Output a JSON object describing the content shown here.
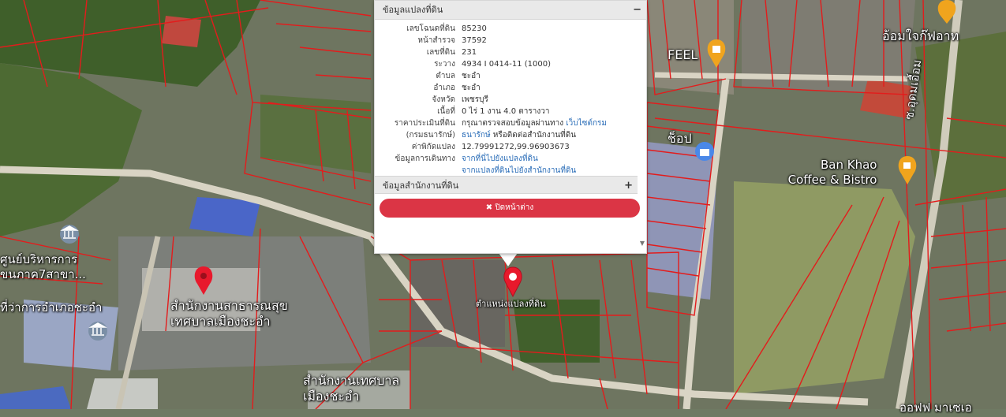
{
  "popup": {
    "section1_title": "ข้อมูลแปลงที่ดิน",
    "section1_toggle": "−",
    "rows": [
      {
        "key": "เลขโฉนดที่ดิน",
        "value": "85230"
      },
      {
        "key": "หน้าสำรวจ",
        "value": "37592"
      },
      {
        "key": "เลขที่ดิน",
        "value": "231"
      },
      {
        "key": "ระวาง",
        "value": "4934 I 0414-11 (1000)"
      },
      {
        "key": "ตำบล",
        "value": "ชะอำ"
      },
      {
        "key": "อำเภอ",
        "value": "ชะอำ"
      },
      {
        "key": "จังหวัด",
        "value": "เพชรบุรี"
      },
      {
        "key": "เนื้อที่",
        "value": "0 ไร่ 1 งาน 4.0 ตารางวา"
      }
    ],
    "price_key_1": "ราคาประเมินที่ดิน",
    "price_key_2": "(กรมธนารักษ์)",
    "price_text": "กรุณาตรวจสอบข้อมูลผ่านทาง",
    "price_link_1": "เว็บไซต์กรม",
    "price_link_2": "ธนารักษ์",
    "price_text_2": "หรือติดต่อสำนักงานที่ดิน",
    "coord_key": "ค่าพิกัดแปลง",
    "coord_value": "12.79991272,99.96903673",
    "travel_key": "ข้อมูลการเดินทาง",
    "travel_link_1": "จากที่นี่ไปยังแปลงที่ดิน",
    "travel_link_2": "จากแปลงที่ดินไปยังสำนักงานที่ดิน",
    "section2_title": "ข้อมูลสำนักงานที่ดิน",
    "section2_toggle": "+",
    "close_label": "✖ ปิดหน้าต่าง"
  },
  "map_labels": {
    "marker_label": "ตำแหน่งแปลงที่ดิน",
    "feel": "FEEL",
    "shop_top_right": "อ้อมใจก๊ฟอาท",
    "shop_fragment": "ช็อป",
    "road": "ซ.อุดมเอื้อม",
    "cafe_1": "Ban Khao",
    "cafe_2": "Coffee & Bistro",
    "center_1": "ศูนย์บริหารการ",
    "center_2": "ขนภาค7สาขา...",
    "district_office": "ที่ว่าการอำเภอชะอำ",
    "health_1": "สำนักงานสาธารณสุข",
    "health_2": "เทศบาลเมืองชะอำ",
    "municipal_1": "สำนักงานเทศบาล",
    "municipal_2": "เมืองชะอำ",
    "bottom_right": "ออฟฟ มาเซเอ"
  },
  "colors": {
    "parcel_line": "#e31c1c",
    "marker": "#e8192c",
    "close_button": "#db3545",
    "link": "#2a6db8"
  }
}
